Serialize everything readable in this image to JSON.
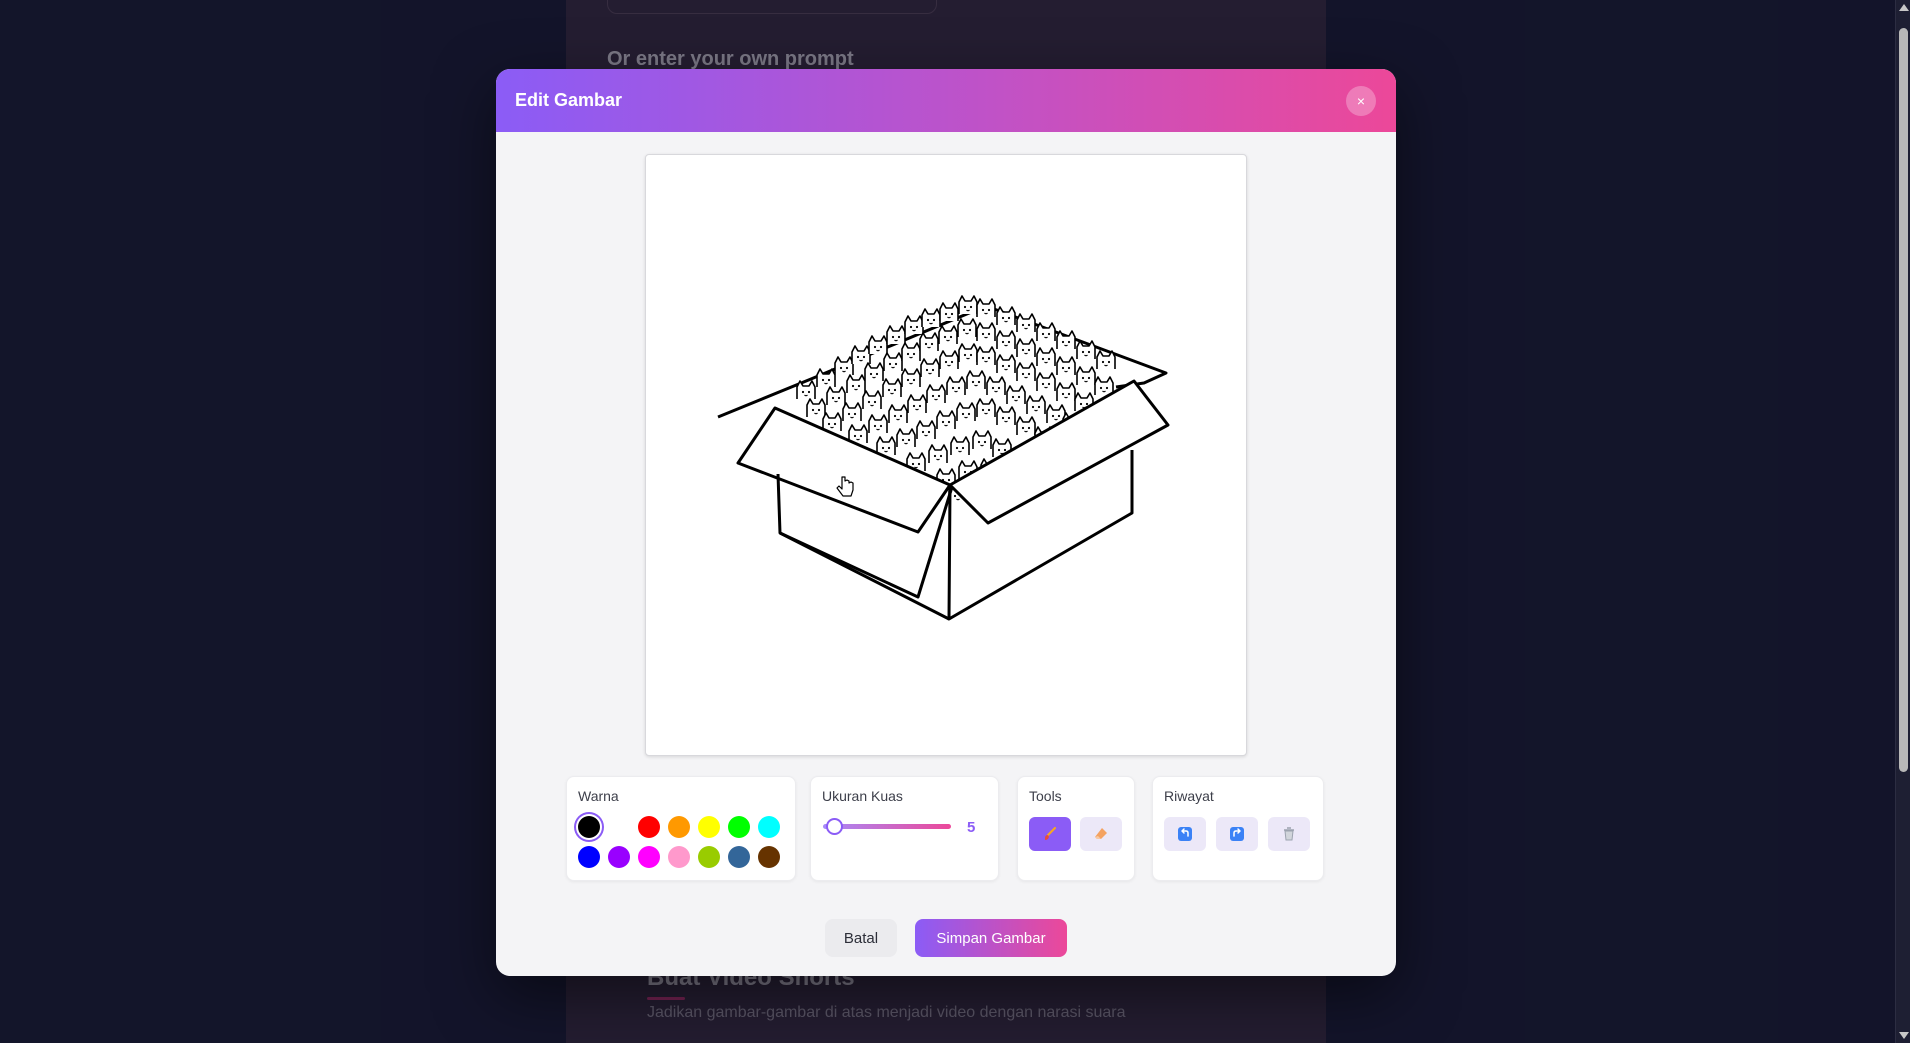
{
  "background": {
    "prompt_heading": "Or enter your own prompt",
    "section_title": "Buat Video Shorts",
    "section_subtitle": "Jadikan gambar-gambar di atas menjadi video dengan narasi suara"
  },
  "modal": {
    "title": "Edit Gambar",
    "close_label": "×"
  },
  "panels": {
    "color": {
      "label": "Warna",
      "selected": "#000000",
      "swatches": [
        "#000000",
        "#ffffff",
        "#ff0000",
        "#ff9900",
        "#ffff00",
        "#00ff00",
        "#00ffff",
        "#0000ff",
        "#9900ff",
        "#ff00ff",
        "#ff99cc",
        "#99cc00",
        "#336699",
        "#663300"
      ]
    },
    "brush_size": {
      "label": "Ukuran Kuas",
      "value": "5"
    },
    "tools": {
      "label": "Tools",
      "items": [
        "brush-icon",
        "eraser-icon"
      ],
      "active": "brush"
    },
    "history": {
      "label": "Riwayat",
      "items": [
        "undo-icon",
        "redo-icon",
        "trash-icon"
      ]
    }
  },
  "actions": {
    "cancel_label": "Batal",
    "save_label": "Simpan Gambar"
  }
}
